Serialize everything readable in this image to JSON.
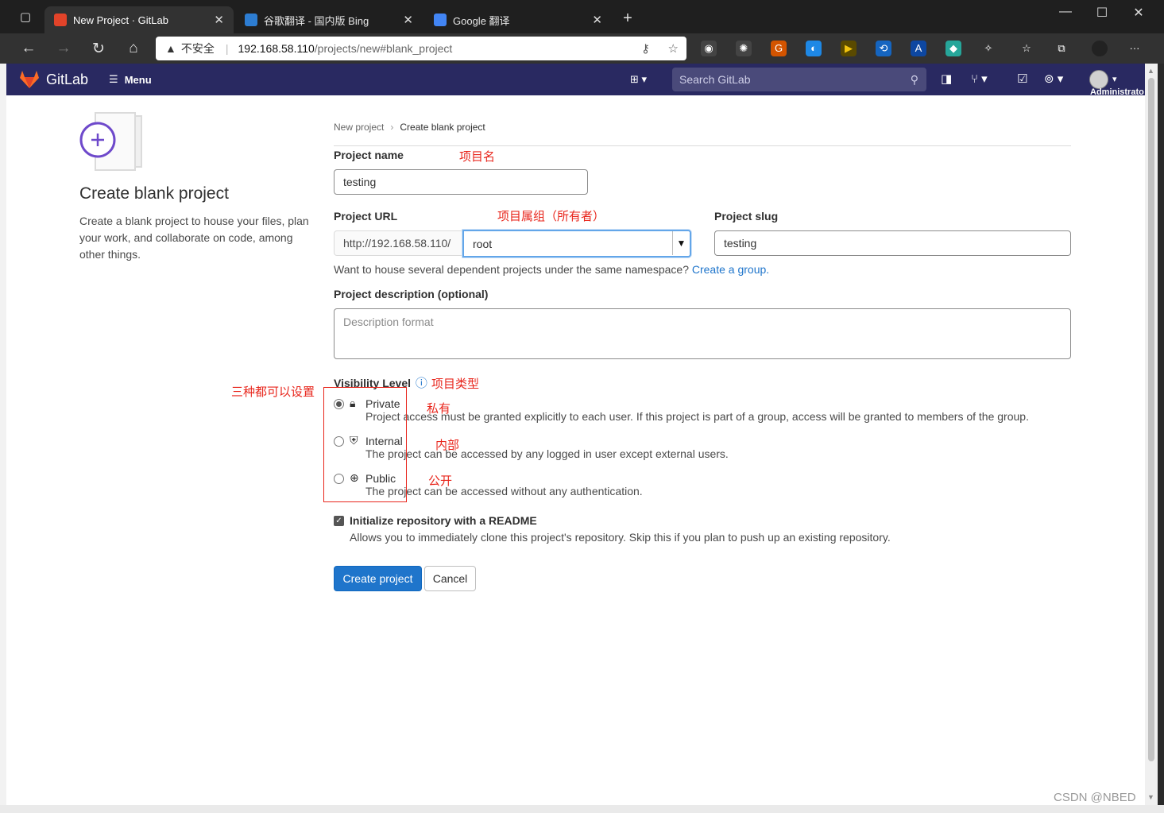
{
  "browser": {
    "tabs": [
      {
        "title": "New Project · GitLab",
        "active": true
      },
      {
        "title": "谷歌翻译 - 国内版 Bing",
        "active": false
      },
      {
        "title": "Google 翻译",
        "active": false
      }
    ],
    "address": {
      "warning": "不安全",
      "host": "192.168.58.110",
      "path": "/projects/new#blank_project"
    }
  },
  "gitlab_header": {
    "brand": "GitLab",
    "menu_label": "Menu",
    "search_placeholder": "Search GitLab",
    "user_label": "Administrato"
  },
  "left": {
    "title": "Create blank project",
    "description": "Create a blank project to house your files, plan your work, and collaborate on code, among other things."
  },
  "breadcrumb": {
    "parent": "New project",
    "current": "Create blank project"
  },
  "form": {
    "project_name_label": "Project name",
    "project_name_value": "testing",
    "project_url_label": "Project URL",
    "url_prefix": "http://192.168.58.110/",
    "namespace_value": "root",
    "slug_label": "Project slug",
    "slug_value": "testing",
    "namespace_hint": "Want to house several dependent projects under the same namespace?",
    "namespace_hint_link": "Create a group.",
    "description_label": "Project description (optional)",
    "description_placeholder": "Description format",
    "visibility_label": "Visibility Level",
    "visibility": [
      {
        "name": "Private",
        "desc": "Project access must be granted explicitly to each user. If this project is part of a group, access will be granted to members of the group.",
        "checked": true
      },
      {
        "name": "Internal",
        "desc": "The project can be accessed by any logged in user except external users.",
        "checked": false
      },
      {
        "name": "Public",
        "desc": "The project can be accessed without any authentication.",
        "checked": false
      }
    ],
    "readme_label": "Initialize repository with a README",
    "readme_desc": "Allows you to immediately clone this project's repository. Skip this if you plan to push up an existing repository.",
    "readme_checked": true,
    "create_button": "Create project",
    "cancel_button": "Cancel"
  },
  "annotations": {
    "project_name": "项目名",
    "project_owner": "项目属组（所有者）",
    "visibility_type": "项目类型",
    "all_settable": "三种都可以设置",
    "private": "私有",
    "internal": "内部",
    "public": "公开"
  },
  "watermark": "CSDN @NBED",
  "colors": {
    "gitlab_nav": "#292961",
    "primary": "#1f75cb",
    "annotation": "#e8261c"
  }
}
